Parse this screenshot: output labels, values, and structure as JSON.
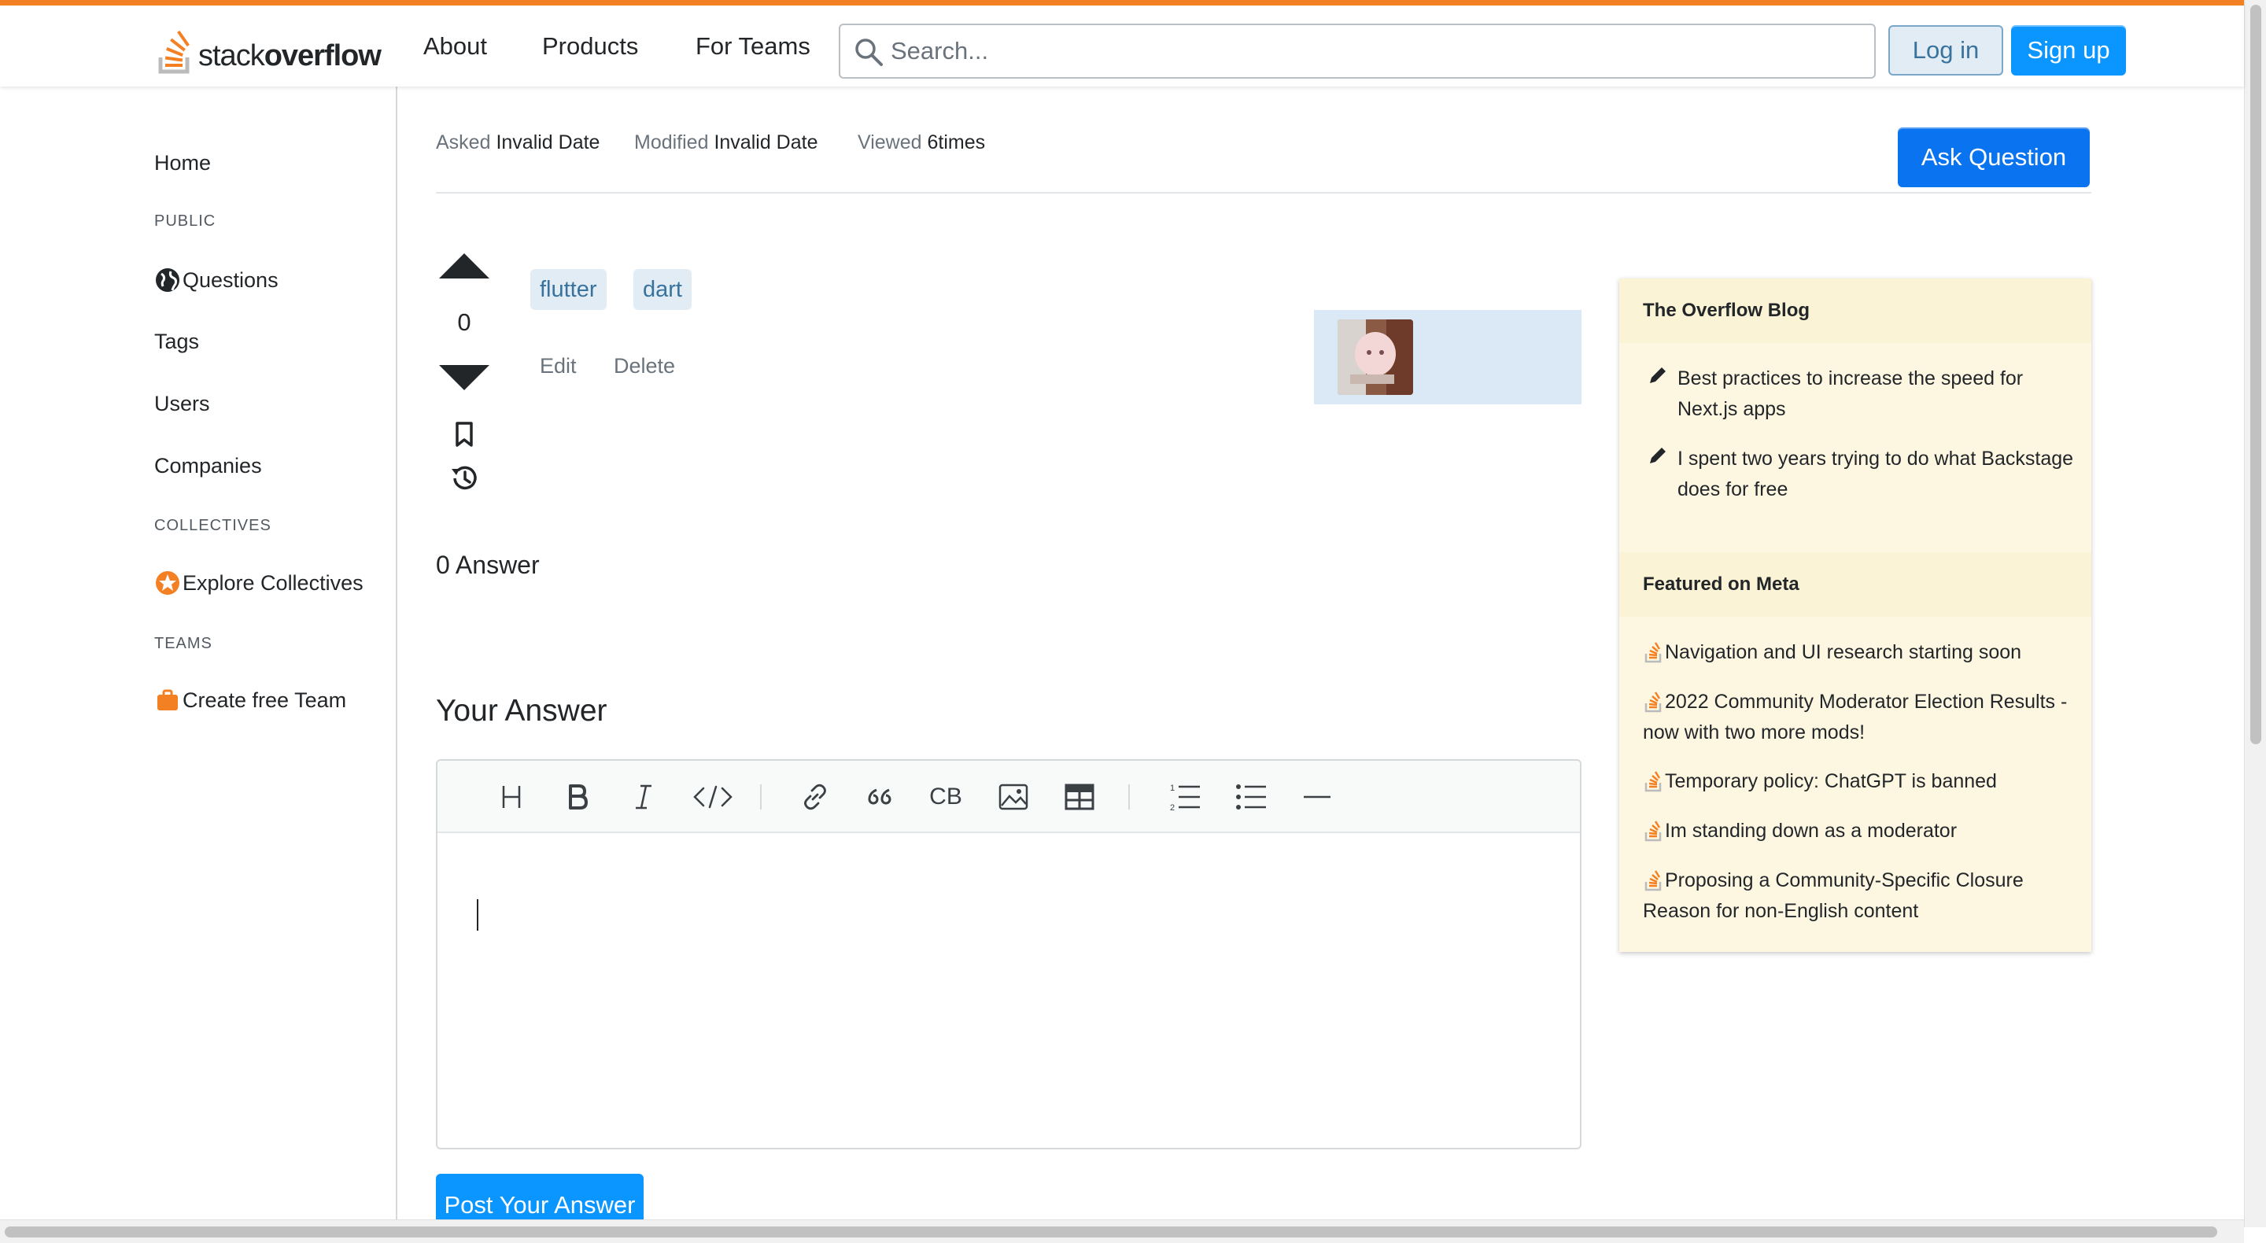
{
  "header": {
    "logo": {
      "text_light": "stack",
      "text_bold": "overflow"
    },
    "nav": [
      "About",
      "Products",
      "For Teams"
    ],
    "search_placeholder": "Search...",
    "login_label": "Log in",
    "signup_label": "Sign up",
    "accent_color": "#f48024"
  },
  "sidebar": {
    "home": "Home",
    "public_heading": "PUBLIC",
    "questions": "Questions",
    "tags": "Tags",
    "users": "Users",
    "companies": "Companies",
    "collectives_heading": "COLLECTIVES",
    "explore_collectives": "Explore Collectives",
    "teams_heading": "TEAMS",
    "create_team": "Create free Team"
  },
  "question": {
    "asked_label": "Asked",
    "asked_value": "Invalid Date",
    "modified_label": "Modified",
    "modified_value": "Invalid Date",
    "viewed_label": "Viewed",
    "viewed_value": "6times",
    "ask_button": "Ask Question",
    "vote_count": "0",
    "tags": [
      "flutter",
      "dart"
    ],
    "edit_label": "Edit",
    "delete_label": "Delete",
    "answers_count_label": "0 Answer"
  },
  "answer_form": {
    "title": "Your Answer",
    "toolbar_icons": [
      "heading-icon",
      "bold-icon",
      "italic-icon",
      "code-icon",
      "link-icon",
      "quote-icon",
      "code-block-icon",
      "image-icon",
      "table-icon",
      "ordered-list-icon",
      "unordered-list-icon",
      "horizontal-rule-icon"
    ],
    "post_button": "Post Your Answer"
  },
  "widget": {
    "blog_heading": "The Overflow Blog",
    "blog_items": [
      "Best practices to increase the speed for Next.js apps",
      "I spent two years trying to do what Backstage does for free"
    ],
    "meta_heading": "Featured on Meta",
    "meta_items": [
      "Navigation and UI research starting soon",
      "2022 Community Moderator Election Results - now with two more mods!",
      "Temporary policy: ChatGPT is banned",
      "Im standing down as a moderator",
      "Proposing a Community-Specific Closure Reason for non-English content"
    ]
  }
}
